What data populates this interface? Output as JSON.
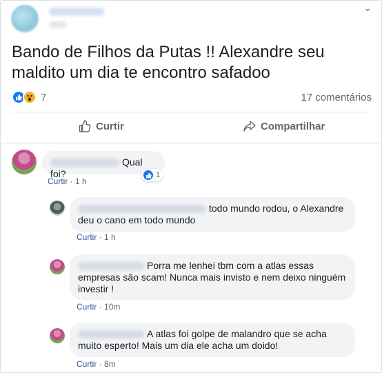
{
  "post": {
    "text": "Bando de Filhos da Putas !! Alexandre seu maldito um dia te encontro safadoo",
    "reaction_count": "7",
    "comments_count": "17 comentários",
    "reaction_icons": [
      "like-icon",
      "wow-icon"
    ]
  },
  "actions": {
    "like_label": "Curtir",
    "share_label": "Compartilhar"
  },
  "comments": [
    {
      "text": "Qual foi?",
      "like_label": "Curtir",
      "time": "1 h",
      "reactions": "1"
    },
    {
      "text": "todo mundo rodou, o Alexandre deu o cano em todo mundo",
      "like_label": "Curtir",
      "time": "1 h"
    },
    {
      "text": "Porra me lenhei tbm com a atlas essas empresas são scam! Nunca mais invisto e nem deixo ninguém investir !",
      "like_label": "Curtir",
      "time": "10m"
    },
    {
      "text": "A atlas foi golpe de malandro que se acha muito esperto! Mais um dia ele acha um doido!",
      "like_label": "Curtir",
      "time": "8m"
    }
  ],
  "colors": {
    "like_blue": "#1877f2",
    "link_blue": "#385898",
    "bubble_bg": "#f2f3f5",
    "muted_text": "#606770"
  }
}
